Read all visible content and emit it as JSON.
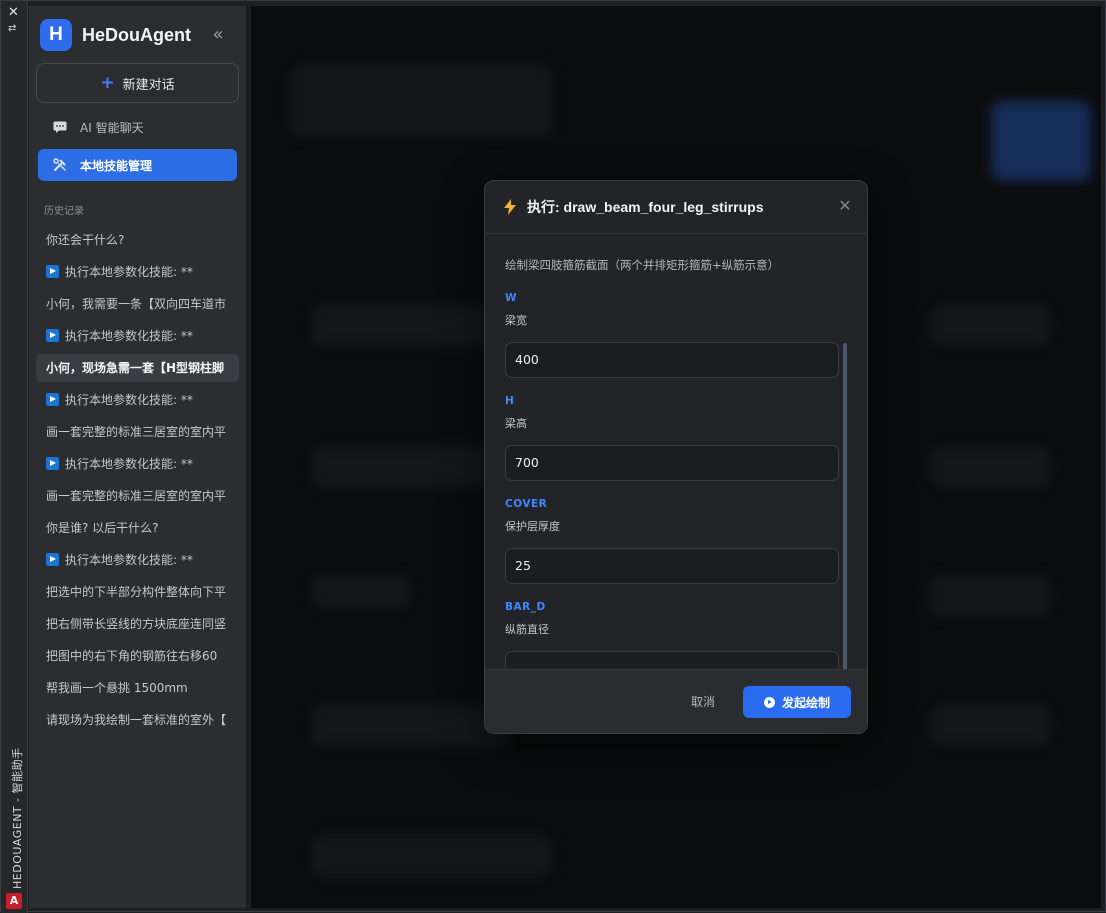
{
  "host": {
    "close_glyph": "✕",
    "dock_glyph": "⇄",
    "vertical_title": "HEDOUAGENT - 智能助手",
    "app_icon": "A"
  },
  "sidebar": {
    "brand_letter": "H",
    "brand_name": "HeDouAgent",
    "collapse_glyph": "«",
    "new_chat_label": "新建对话",
    "nav": [
      {
        "label": "AI 智能聊天",
        "icon": "chat-bubble-icon",
        "active": false
      },
      {
        "label": "本地技能管理",
        "icon": "tools-icon",
        "active": true
      }
    ],
    "history_title": "历史记录",
    "history": [
      {
        "text": "你还会干什么?",
        "play": false
      },
      {
        "text": "执行本地参数化技能: **",
        "play": true
      },
      {
        "text": "小何，我需要一条【双向四车道市",
        "play": false
      },
      {
        "text": "执行本地参数化技能: **",
        "play": true
      },
      {
        "text": "小何，现场急需一套【H型钢柱脚",
        "play": false,
        "active": true
      },
      {
        "text": "执行本地参数化技能: **",
        "play": true
      },
      {
        "text": "画一套完整的标准三居室的室内平",
        "play": false
      },
      {
        "text": "执行本地参数化技能: **",
        "play": true
      },
      {
        "text": "画一套完整的标准三居室的室内平",
        "play": false
      },
      {
        "text": "你是谁? 以后干什么?",
        "play": false
      },
      {
        "text": "执行本地参数化技能: **",
        "play": true
      },
      {
        "text": "把选中的下半部分构件整体向下平",
        "play": false
      },
      {
        "text": "把右侧带长竖线的方块底座连同竖",
        "play": false
      },
      {
        "text": "把图中的右下角的钢筋往右移60",
        "play": false
      },
      {
        "text": "帮我画一个悬挑 1500mm",
        "play": false
      },
      {
        "text": "请现场为我绘制一套标准的室外【",
        "play": false
      }
    ]
  },
  "modal": {
    "title": "执行: draw_beam_four_leg_stirrups",
    "close_glyph": "✕",
    "description": "绘制梁四肢箍筋截面（两个并排矩形箍筋+纵筋示意）",
    "fields": [
      {
        "key": "W",
        "label": "梁宽",
        "value": "400"
      },
      {
        "key": "H",
        "label": "梁高",
        "value": "700"
      },
      {
        "key": "COVER",
        "label": "保护层厚度",
        "value": "25"
      },
      {
        "key": "BAR_D",
        "label": "纵筋直径",
        "value": ""
      }
    ],
    "cancel_label": "取消",
    "submit_label": "发起绘制"
  },
  "colors": {
    "accent": "#2d6de6",
    "field_key": "#3f86ff",
    "sidebar_bg": "#2b2d31",
    "modal_bg": "#232427",
    "overlay_bg": "#0b0c0d"
  }
}
